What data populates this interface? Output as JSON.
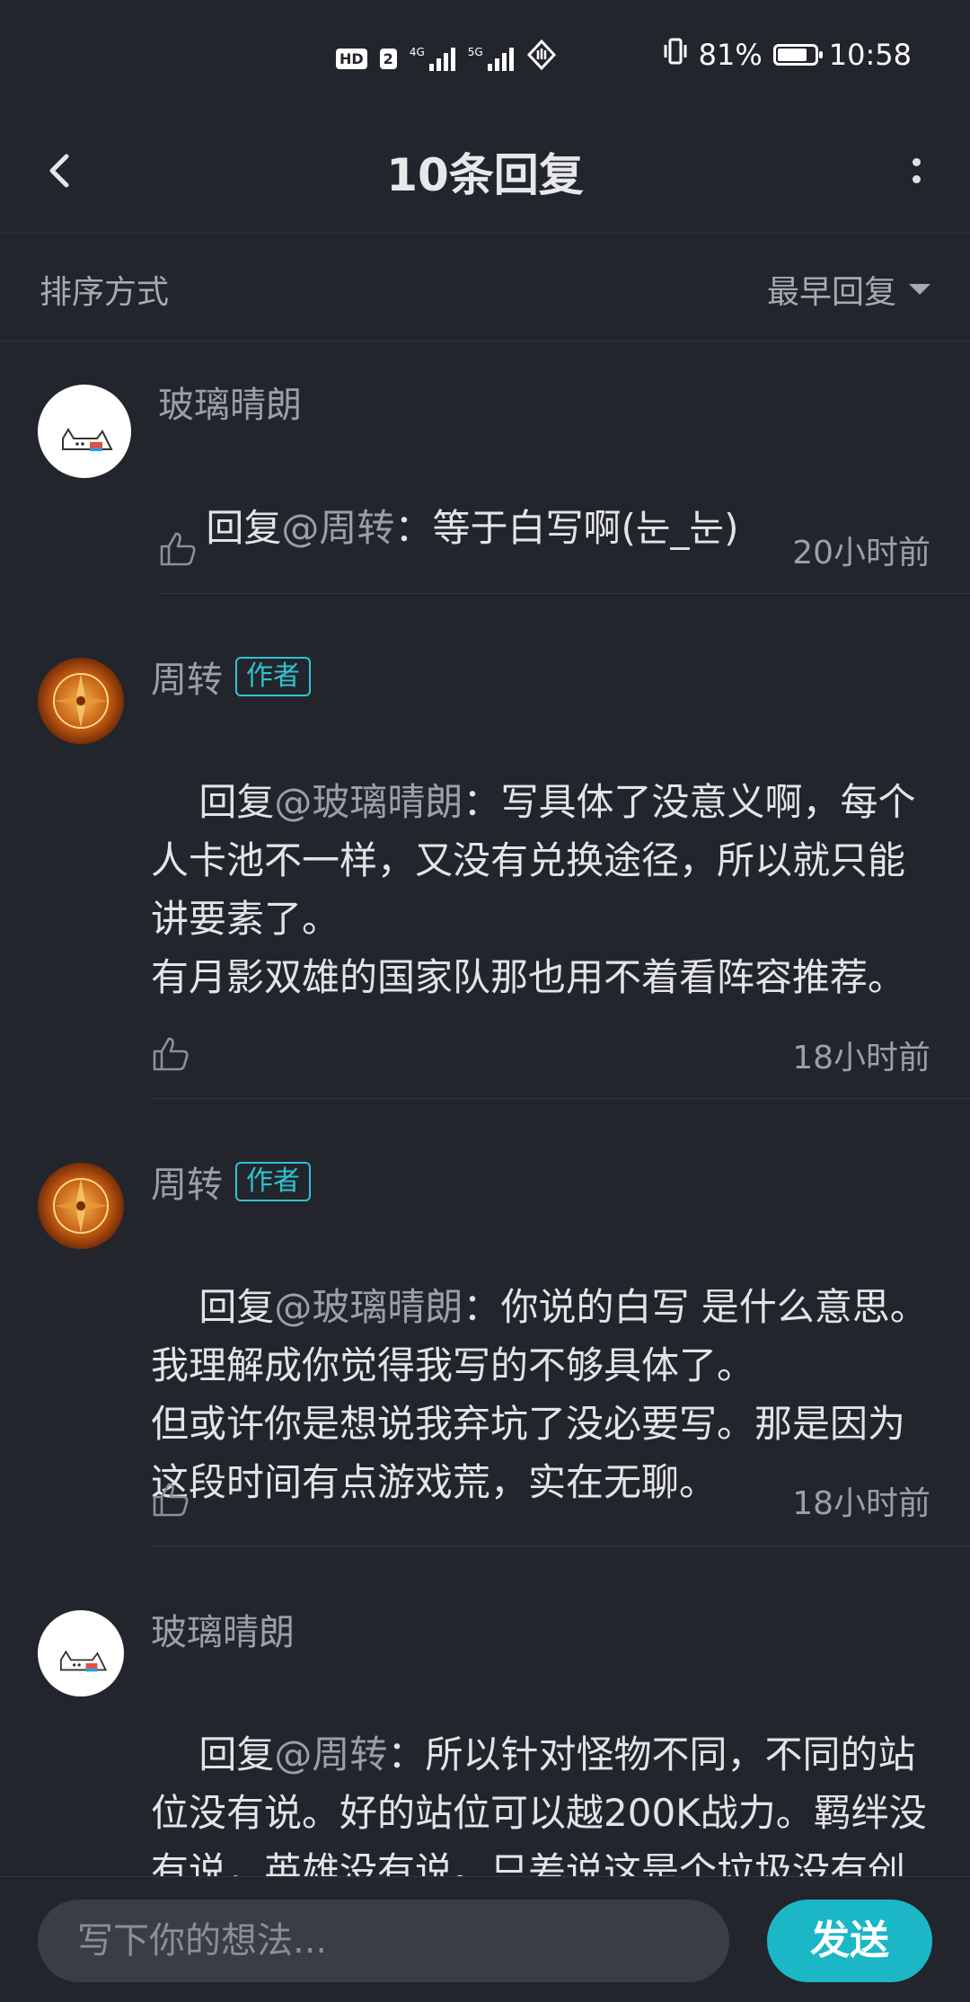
{
  "status_bar": {
    "hd_label": "HD",
    "sim_label": "2",
    "net1": "4G",
    "net2": "5G",
    "battery_text": "81%",
    "battery_level": 0.81,
    "time": "10:58"
  },
  "header": {
    "title": "10条回复"
  },
  "sort": {
    "label": "排序方式",
    "value": "最早回复"
  },
  "comments": [
    {
      "author": "玻璃晴朗",
      "badge": "",
      "reply_prefix": "回复",
      "reply_to": "@周转",
      "reply_sep": "：",
      "body": "等于白写啊(눈_눈)",
      "time": "20小时前"
    },
    {
      "author": "周转",
      "badge": "作者",
      "reply_prefix": "回复",
      "reply_to": "@玻璃晴朗",
      "reply_sep": "：",
      "body": "写具体了没意义啊，每个人卡池不一样，又没有兑换途径，所以就只能讲要素了。\n有月影双雄的国家队那也用不着看阵容推荐。",
      "time": "18小时前"
    },
    {
      "author": "周转",
      "badge": "作者",
      "reply_prefix": "回复",
      "reply_to": "@玻璃晴朗",
      "reply_sep": "：",
      "body": "你说的白写 是什么意思。\n我理解成你觉得我写的不够具体了。\n但或许你是想说我弃坑了没必要写。那是因为这段时间有点游戏荒，实在无聊。",
      "time": "18小时前"
    },
    {
      "author": "玻璃晴朗",
      "badge": "",
      "reply_prefix": "回复",
      "reply_to": "@周转",
      "reply_sep": "：",
      "body": "所以针对怪物不同，不同的站位没有说。好的站位可以越200K战力。羁绊没有说，英雄没有说。只差说这是个垃圾没有创新的游戏游戏了",
      "time": ""
    }
  ],
  "composer": {
    "placeholder": "写下你的想法...",
    "send_label": "发送"
  }
}
